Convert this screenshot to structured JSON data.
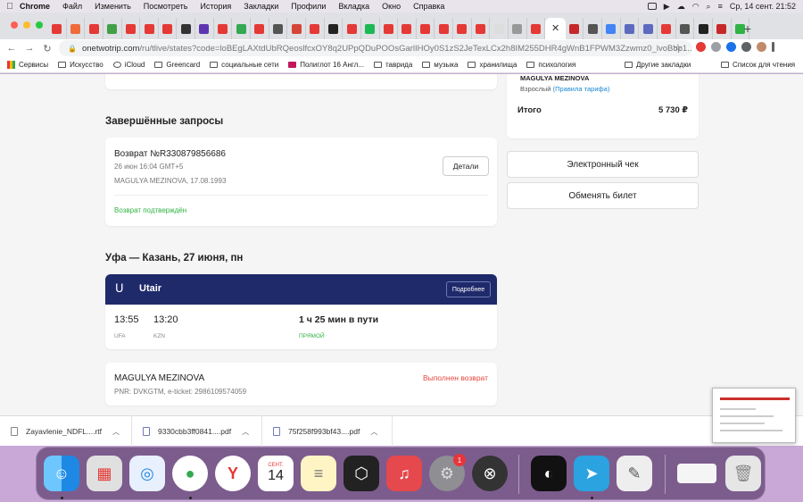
{
  "menubar": {
    "app": "Chrome",
    "items": [
      "Файл",
      "Изменить",
      "Посмотреть",
      "История",
      "Закладки",
      "Профили",
      "Вкладка",
      "Окно",
      "Справка"
    ],
    "datetime": "Ср, 14 сент.  21:52"
  },
  "tabs": {
    "favicon_colors": [
      "#e53935",
      "#ef6c3a",
      "#e53935",
      "#43a047",
      "#e53935",
      "#e53935",
      "#e53935",
      "#333333",
      "#5e35b1",
      "#e53935",
      "#34a853",
      "#e53935",
      "#555555",
      "#d44638",
      "#e53935",
      "#222222",
      "#e53935",
      "#1db954",
      "#e53935",
      "#e53935",
      "#e53935",
      "#e53935",
      "#e53935",
      "#e53935",
      "#dddddd",
      "#999999",
      "#e53935",
      "#c62828",
      "#555555",
      "#4285f4",
      "#5c6bc0",
      "#5c6bc0",
      "#e53935",
      "#555555"
    ],
    "active_close": "✕",
    "right_favicons": [
      "#222222",
      "#c62828",
      "#2fb344"
    ],
    "new_tab": "+"
  },
  "address": {
    "host": "onetwotrip.com",
    "path": "/ru/tlive/states?code=loBEgLAXtdUbRQeoslfcxOY8q2UPpQDuPOOsGarlIHOy0S1zS2JeTexLCx2h8IM255DHR4gWnB1FPWM3Zzwmz0_lvoBbp1..."
  },
  "bookmarks": {
    "items": [
      "Сервисы",
      "Искусство",
      "iCloud",
      "Greencard",
      "социальные сети",
      "Полиглот 16 Англ...",
      "таврида",
      "музыка",
      "хранилища",
      "психология"
    ],
    "other": "Другие закладки",
    "reading_list": "Список для чтения"
  },
  "order": {
    "passenger_name": "MAGULYA MEZINOVA",
    "fare_type": "Взрослый",
    "fare_rules_link": "(Правила тарифа)",
    "total_label": "Итого",
    "total_value": "5 730 ₽",
    "receipt_button": "Электронный чек",
    "exchange_button": "Обменять билет"
  },
  "completed": {
    "heading": "Завершённые запросы",
    "request_title": "Возврат №R330879856686",
    "request_date": "26 июн 16:04 GMT+5",
    "request_passenger": "MAGULYA MEZINOVA, 17.08.1993",
    "details_button": "Детали",
    "status": "Возврат подтверждён"
  },
  "flight": {
    "heading": "Уфа — Казань, 27 июня, пн",
    "airline": "Utair",
    "more_button": "Подробнее",
    "depart_time": "13:55",
    "arrive_time": "13:20",
    "depart_code": "UFA",
    "arrive_code": "KZN",
    "duration": "1 ч 25 мин в пути",
    "direct": "ПРЯМОЙ"
  },
  "passenger": {
    "name": "MAGULYA MEZINOVA",
    "pnr": "PNR: DVKGTM, e-ticket: 2986109574059",
    "status": "Выполнен возврат"
  },
  "downloads": [
    {
      "name": "Zayavlenie_NDFL....rtf"
    },
    {
      "name": "9330cbb3ff0841....pdf"
    },
    {
      "name": "75f258f993bf43....pdf"
    }
  ],
  "dock": {
    "calendar_month": "СЕНТ.",
    "calendar_day": "14",
    "settings_badge": "1"
  }
}
